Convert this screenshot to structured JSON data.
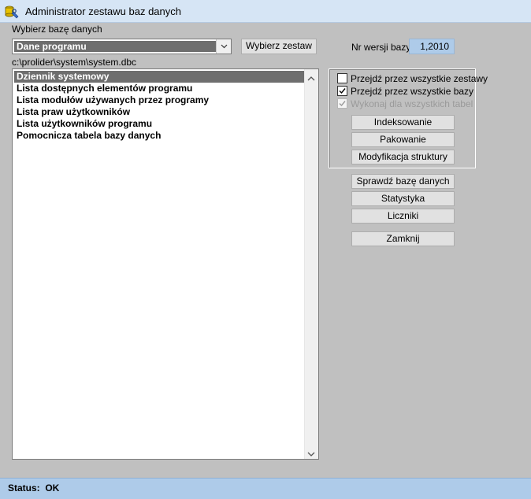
{
  "window": {
    "title": "Administrator zestawu baz danych",
    "icon": "database-tool-icon"
  },
  "select_db": {
    "label": "Wybierz bazę danych",
    "selected": "Dane programu"
  },
  "buttons": {
    "choose_set": "Wybierz zestaw",
    "indexing": "Indeksowanie",
    "packing": "Pakowanie",
    "modify_structure": "Modyfikacja  struktury",
    "check_db": "Sprawdź bazę danych",
    "statistics": "Statystyka",
    "counters": "Liczniki",
    "close": "Zamknij"
  },
  "version": {
    "label": "Nr wersji bazy",
    "value": "1,2010"
  },
  "path": "c:\\prolider\\system\\system.dbc",
  "tables": [
    "Dziennik systemowy",
    "Lista dostępnych elementów programu",
    "Lista modułów używanych przez programy",
    "Lista praw użytkowników",
    "Lista użytkowników programu",
    "Pomocnicza tabela bazy danych"
  ],
  "selected_table": "Dziennik systemowy",
  "options": {
    "all_sets": {
      "label": "Przejdź przez wszystkie zestawy",
      "checked": false,
      "enabled": true
    },
    "all_dbs": {
      "label": "Przejdź przez wszystkie bazy",
      "checked": true,
      "enabled": true
    },
    "all_tables": {
      "label": "Wykonaj dla wszystkich  tabel",
      "checked": true,
      "enabled": false
    }
  },
  "status": {
    "label": "Status:",
    "value": "OK"
  }
}
